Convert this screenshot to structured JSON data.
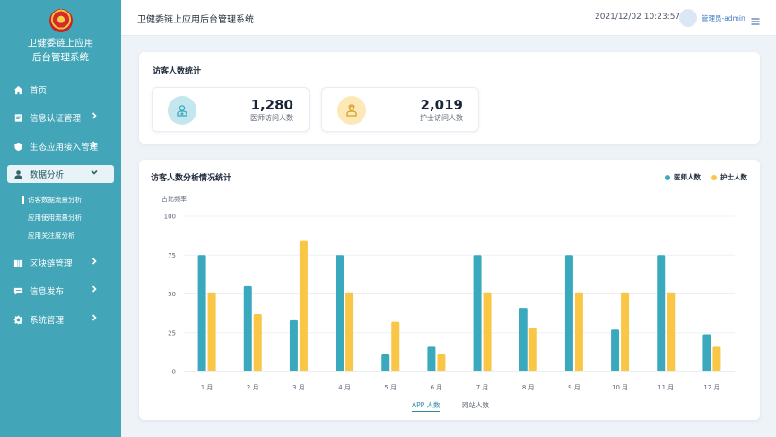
{
  "sidebar": {
    "brand_line1": "卫健委链上应用",
    "brand_line2": "后台管理系统",
    "items": [
      {
        "label": "首页"
      },
      {
        "label": "信息认证管理"
      },
      {
        "label": "生态应用接入管理"
      },
      {
        "label": "数据分析"
      },
      {
        "label": "区块链管理"
      },
      {
        "label": "信息发布"
      },
      {
        "label": "系统管理"
      }
    ],
    "sub_items": [
      {
        "label": "访客数据流量分析"
      },
      {
        "label": "应用使用流量分析"
      },
      {
        "label": "应用关注度分析"
      }
    ]
  },
  "header": {
    "title": "卫健委链上应用后台管理系统",
    "datetime": "2021/12/02 10:23:57",
    "user": "管理员-admin"
  },
  "visitor_stats": {
    "title": "访客人数统计",
    "cards": [
      {
        "value": "1,280",
        "label": "医师访问人数"
      },
      {
        "value": "2,019",
        "label": "护士访问人数"
      }
    ]
  },
  "analysis": {
    "title": "访客人数分析情况统计",
    "tabs": [
      {
        "label": "APP 人数",
        "active": true
      },
      {
        "label": "网站人数",
        "active": false
      }
    ]
  },
  "colors": {
    "doctor": "#3aa9bd",
    "nurse": "#f9c646",
    "sidebar": "#43a6b8"
  },
  "chart_data": {
    "type": "bar",
    "ylabel": "占比频率",
    "ylim": [
      0,
      100
    ],
    "yticks": [
      0,
      25,
      50,
      75,
      100
    ],
    "categories": [
      "1 月",
      "2 月",
      "3 月",
      "4 月",
      "5 月",
      "6 月",
      "7 月",
      "8 月",
      "9 月",
      "10 月",
      "11 月",
      "12 月"
    ],
    "series": [
      {
        "name": "医师人数",
        "values": [
          75,
          55,
          33,
          75,
          11,
          16,
          75,
          41,
          75,
          27,
          75,
          24
        ]
      },
      {
        "name": "护士人数",
        "values": [
          51,
          37,
          84,
          51,
          32,
          11,
          51,
          28,
          51,
          51,
          51,
          16
        ]
      }
    ],
    "grid": true,
    "legend": "top-right"
  }
}
